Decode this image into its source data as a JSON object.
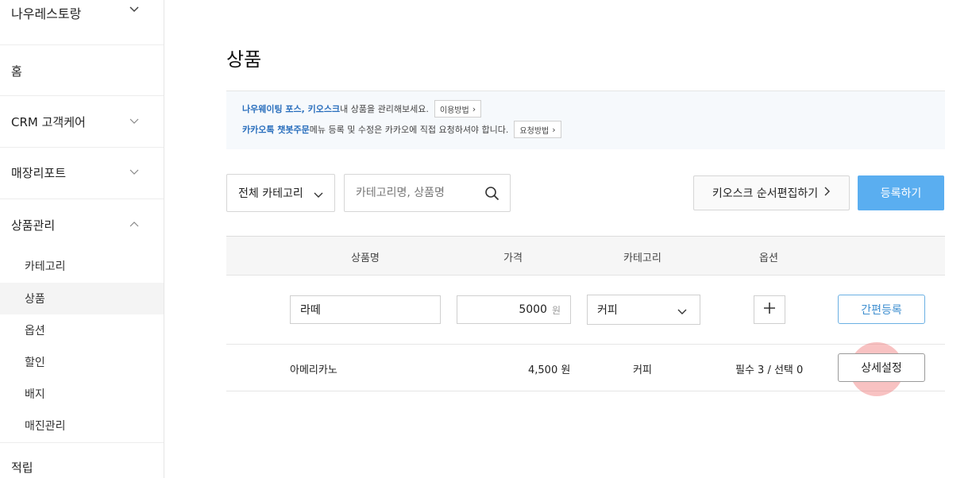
{
  "sidebar": {
    "store": "나우레스토랑",
    "home": "홈",
    "crm": "CRM 고객케어",
    "report": "매장리포트",
    "product_mgmt": "상품관리",
    "sub_items": [
      "카테고리",
      "상품",
      "옵션",
      "할인",
      "배지",
      "매진관리"
    ],
    "points": "적립"
  },
  "page": {
    "title": "상품"
  },
  "info": {
    "line1_highlight": "나우웨이팅 포스, 키오스크",
    "line1_text": " 내 상품을 관리해보세요.",
    "line1_button": "이용방법",
    "line2_highlight": "카카오톡 챗봇주문",
    "line2_text": " 메뉴 등록 및 수정은 카카오에 직접 요청하셔야 합니다.",
    "line2_button": "요청방법"
  },
  "toolbar": {
    "category_filter": "전체 카테고리",
    "search_placeholder": "카테고리명, 상품명",
    "kiosk_button": "키오스크 순서편집하기",
    "register_button": "등록하기"
  },
  "table": {
    "headers": [
      "상품명",
      "가격",
      "카테고리",
      "옵션"
    ],
    "new_row": {
      "name": "라떼",
      "price": "5000",
      "unit": "원",
      "category": "커피",
      "quick_button": "간편등록"
    },
    "rows": [
      {
        "name": "아메리카노",
        "price": "4,500 원",
        "category": "커피",
        "options": "필수 3 / 선택 0",
        "action": "상세설정"
      }
    ]
  },
  "colors": {
    "accent": "#5aaef0",
    "link": "#2a6fbd"
  }
}
